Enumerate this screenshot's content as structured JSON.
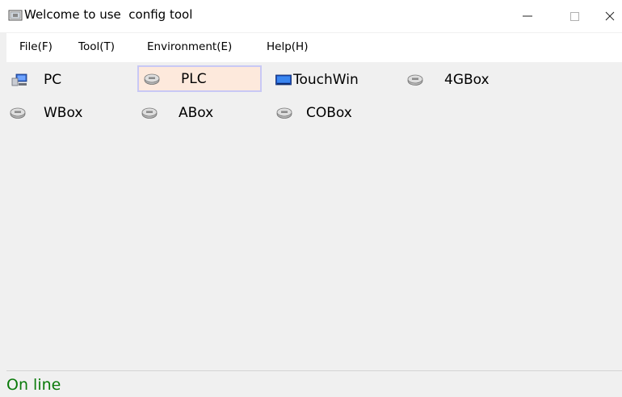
{
  "window": {
    "title": "Welcome to use  config tool",
    "minimize_icon": "minimize-icon",
    "maximize_icon": "maximize-icon",
    "close_icon": "close-icon"
  },
  "menu": {
    "items": [
      {
        "label": "File(F)"
      },
      {
        "label": "Tool(T)"
      },
      {
        "label": "Environment(E)"
      },
      {
        "label": "Help(H)"
      }
    ]
  },
  "tools": {
    "row1": [
      {
        "label": "PC",
        "icon": "pc-icon"
      },
      {
        "label": "PLC",
        "icon": "device-icon",
        "selected": true
      },
      {
        "label": "TouchWin",
        "icon": "touchwin-icon"
      },
      {
        "label": "4GBox",
        "icon": "device-icon"
      }
    ],
    "row2": [
      {
        "label": "WBox",
        "icon": "device-icon"
      },
      {
        "label": "ABox",
        "icon": "device-icon"
      },
      {
        "label": "COBox",
        "icon": "device-icon"
      }
    ]
  },
  "status": {
    "text": "On line",
    "color": "#0a7a0a"
  },
  "colors": {
    "selection_fill": "#fde9dc",
    "selection_border": "#c8c8f5",
    "background": "#f0f0f0"
  }
}
